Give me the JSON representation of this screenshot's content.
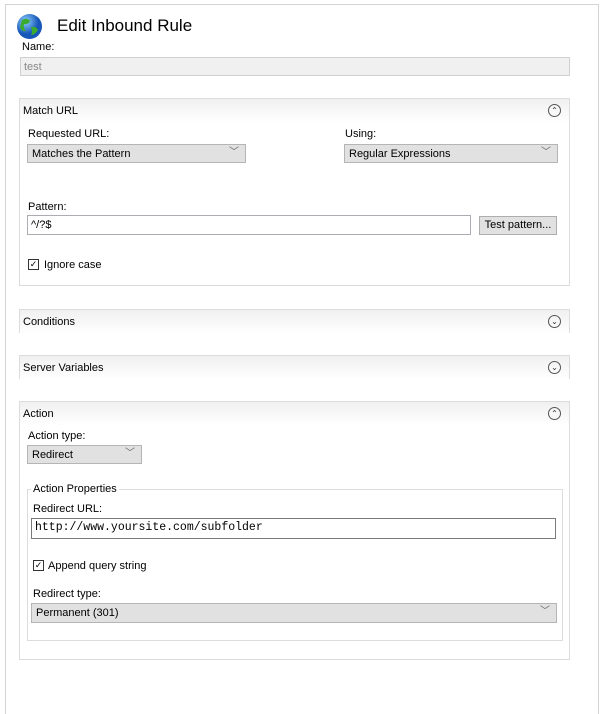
{
  "title": "Edit Inbound Rule",
  "name": {
    "label": "Name:",
    "value": "test"
  },
  "match_url": {
    "header": "Match URL",
    "requested_url_label": "Requested URL:",
    "requested_url_value": "Matches the Pattern",
    "using_label": "Using:",
    "using_value": "Regular Expressions",
    "pattern_label": "Pattern:",
    "pattern_value": "^/?$",
    "test_pattern_button": "Test pattern...",
    "ignore_case_label": "Ignore case",
    "ignore_case_checked": true
  },
  "conditions": {
    "header": "Conditions"
  },
  "server_variables": {
    "header": "Server Variables"
  },
  "action": {
    "header": "Action",
    "action_type_label": "Action type:",
    "action_type_value": "Redirect",
    "properties_legend": "Action Properties",
    "redirect_url_label": "Redirect URL:",
    "redirect_url_value": "http://www.yoursite.com/subfolder",
    "append_query_label": "Append query string",
    "append_query_checked": true,
    "redirect_type_label": "Redirect type:",
    "redirect_type_value": "Permanent (301)"
  }
}
